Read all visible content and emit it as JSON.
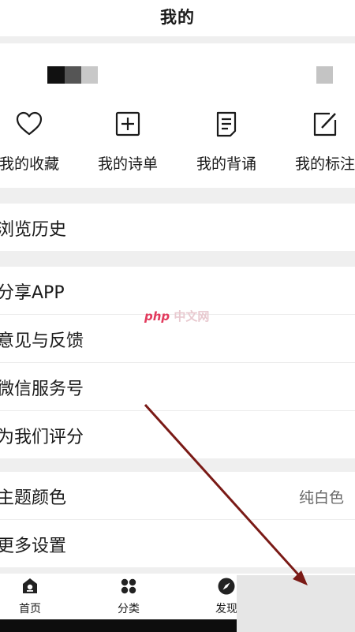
{
  "header": {
    "title": "我的"
  },
  "quick_actions": [
    {
      "label": "我的收藏",
      "icon": "heart-icon"
    },
    {
      "label": "我的诗单",
      "icon": "plus-square-icon"
    },
    {
      "label": "我的背诵",
      "icon": "document-icon"
    },
    {
      "label": "我的标注",
      "icon": "edit-icon"
    }
  ],
  "menu": {
    "history": "浏览历史",
    "share": "分享APP",
    "feedback": "意见与反馈",
    "wechat": "微信服务号",
    "rate": "为我们评分",
    "theme": "主题颜色",
    "theme_value": "纯白色",
    "more_settings": "更多设置"
  },
  "watermark": {
    "brand": "php",
    "text": "中文网"
  },
  "tabbar": {
    "items": [
      {
        "label": "首页",
        "icon": "home-icon"
      },
      {
        "label": "分类",
        "icon": "category-icon"
      },
      {
        "label": "发现",
        "icon": "compass-icon"
      }
    ]
  },
  "colors": {
    "arrow": "#7a1a16",
    "background": "#efefef",
    "watermark": "#e23a5d"
  }
}
